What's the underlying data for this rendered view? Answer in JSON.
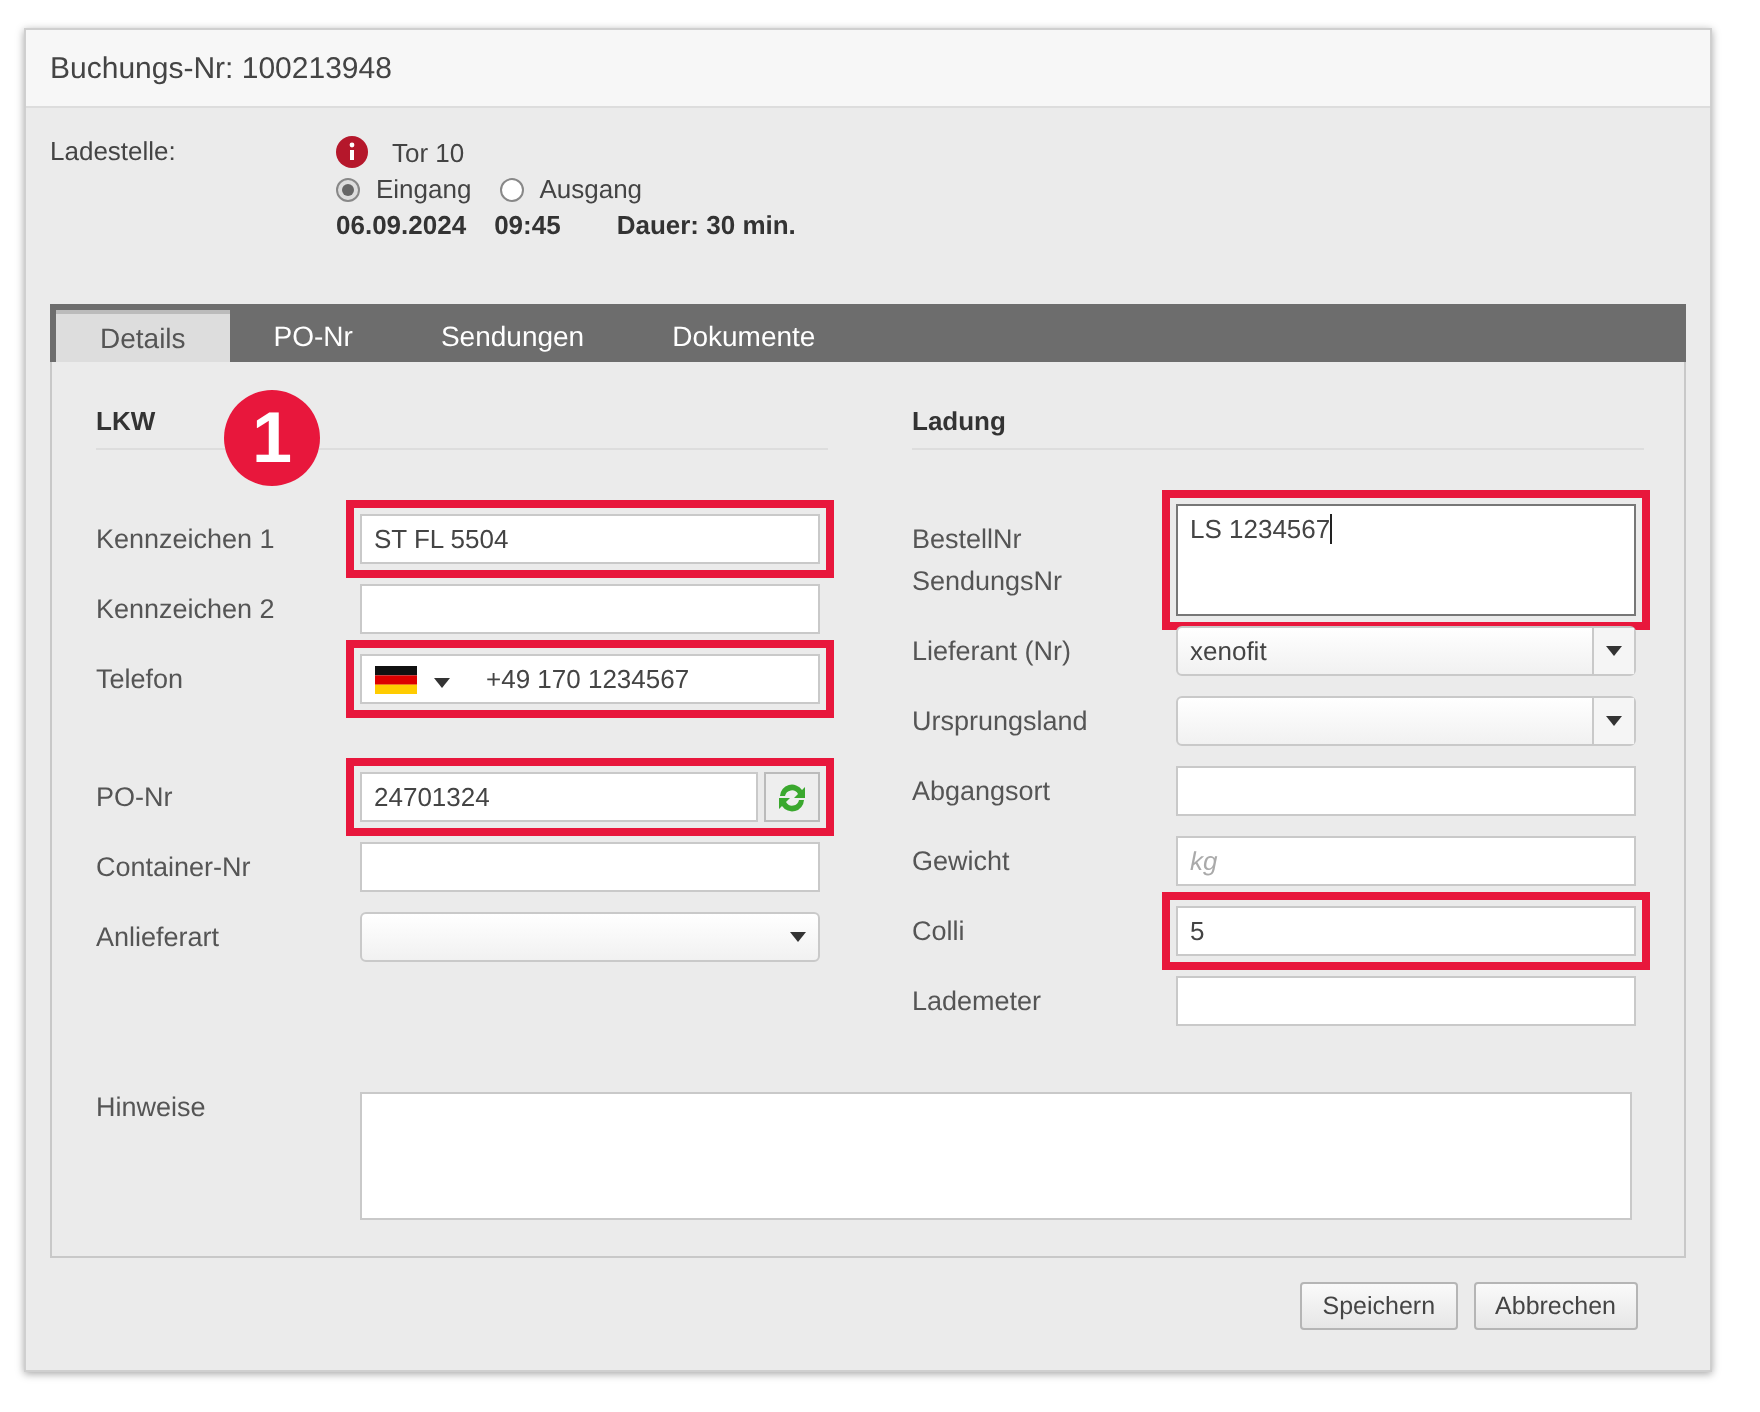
{
  "window": {
    "title": "Buchungs-Nr: 100213948"
  },
  "header": {
    "label": "Ladestelle:",
    "location": "Tor 10",
    "direction": [
      {
        "label": "Eingang",
        "selected": true
      },
      {
        "label": "Ausgang",
        "selected": false
      }
    ],
    "date": "06.09.2024",
    "time": "09:45",
    "duration": "Dauer: 30 min."
  },
  "tabs": [
    {
      "label": "Details",
      "selected": true
    },
    {
      "label": "PO-Nr",
      "selected": false
    },
    {
      "label": "Sendungen",
      "selected": false
    },
    {
      "label": "Dokumente",
      "selected": false
    }
  ],
  "step_badge": "1",
  "left": {
    "title": "LKW",
    "fields": [
      {
        "kind": "text",
        "labels": [
          "Kennzeichen 1"
        ],
        "value": "ST FL 5504",
        "highlighted": true
      },
      {
        "kind": "text",
        "labels": [
          "Kennzeichen 2"
        ],
        "highlighted": false
      },
      {
        "kind": "phone",
        "labels": [
          "Telefon"
        ],
        "value": "+49 170 1234567",
        "highlighted": true
      },
      {
        "kind": "lookup",
        "labels": [
          "PO-Nr"
        ],
        "value": "24701324",
        "highlighted": true
      },
      {
        "kind": "text",
        "labels": [
          "Container-Nr"
        ],
        "highlighted": false
      },
      {
        "kind": "select",
        "labels": [
          "Anlieferart"
        ],
        "highlighted": false
      }
    ]
  },
  "right": {
    "title": "Ladung",
    "fields": [
      {
        "kind": "textarea",
        "labels": [
          "BestellNr",
          "SendungsNr"
        ],
        "value": "LS 1234567",
        "highlighted": true
      },
      {
        "kind": "combo",
        "labels": [
          "Lieferant (Nr)"
        ],
        "value": "xenofit",
        "highlighted": false
      },
      {
        "kind": "combo",
        "labels": [
          "Ursprungsland"
        ],
        "highlighted": false
      },
      {
        "kind": "text",
        "labels": [
          "Abgangsort"
        ],
        "highlighted": false
      },
      {
        "kind": "text",
        "labels": [
          "Gewicht"
        ],
        "placeholder": "kg",
        "highlighted": false
      },
      {
        "kind": "text",
        "labels": [
          "Colli"
        ],
        "value": "5",
        "highlighted": true
      },
      {
        "kind": "text",
        "labels": [
          "Lademeter"
        ],
        "highlighted": false
      }
    ]
  },
  "notes": {
    "label": "Hinweise"
  },
  "buttons": [
    "Speichern",
    "Abbrechen"
  ]
}
